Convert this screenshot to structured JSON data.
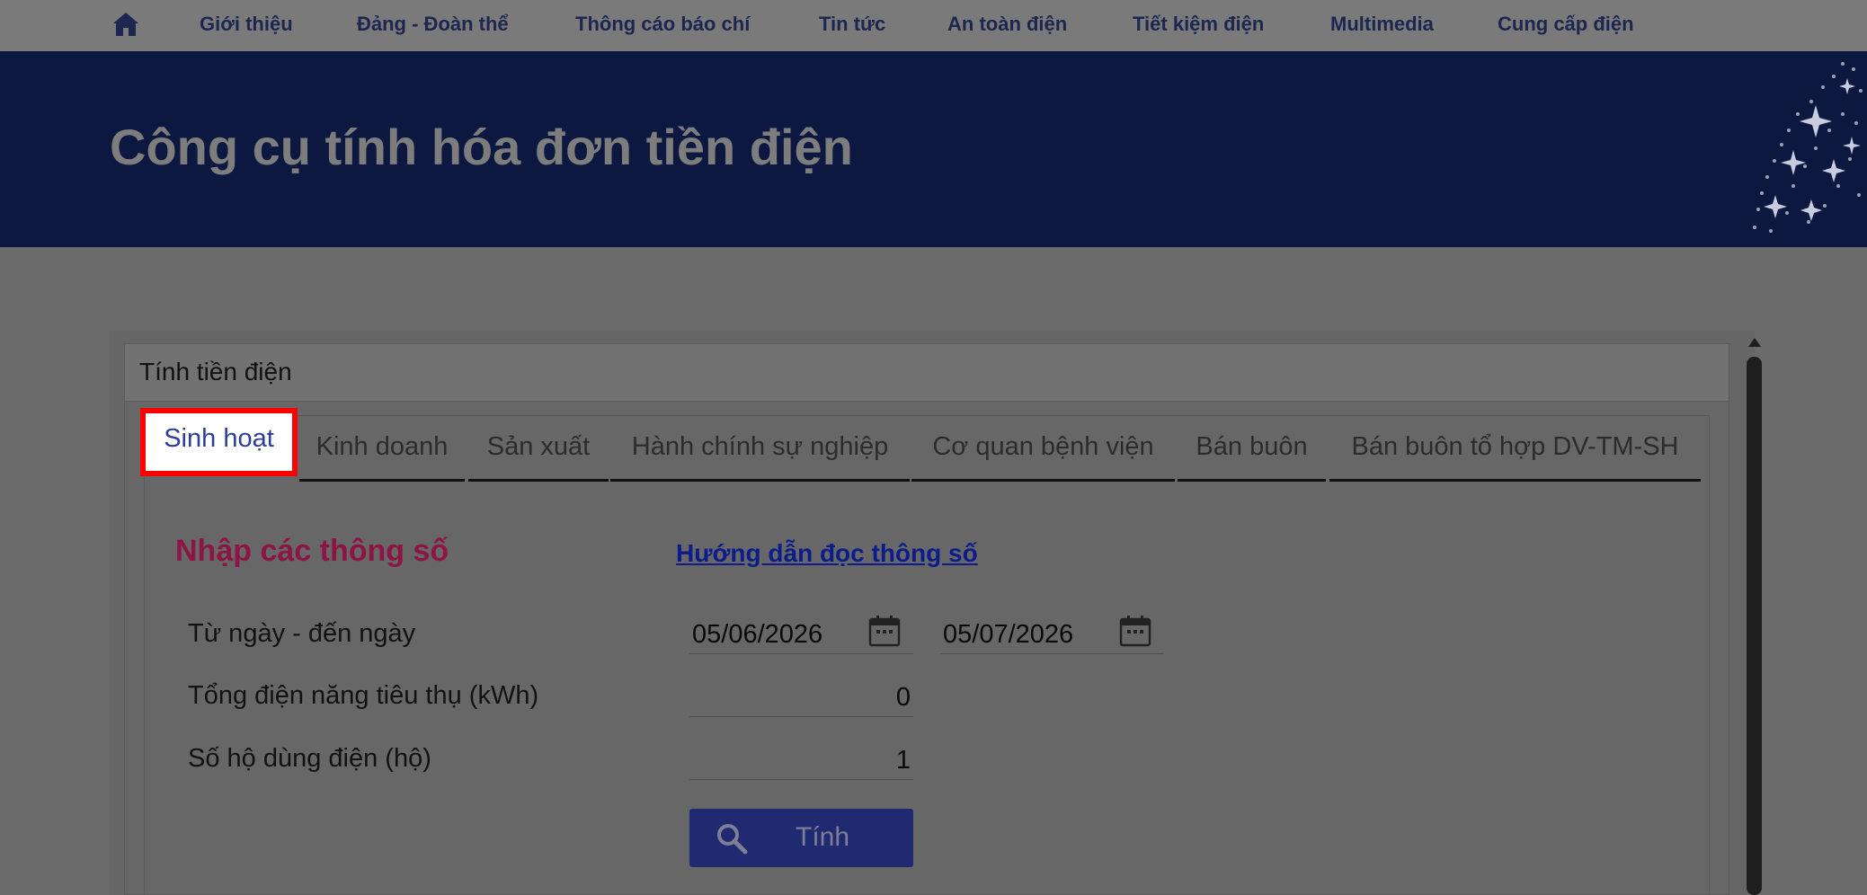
{
  "nav": {
    "home_icon": "home-icon",
    "items": [
      "Giới thiệu",
      "Đảng - Đoàn thể",
      "Thông cáo báo chí",
      "Tin tức",
      "An toàn điện",
      "Tiết kiệm điện",
      "Multimedia",
      "Cung cấp điện"
    ]
  },
  "banner": {
    "title": "Công cụ tính hóa đơn tiền điện"
  },
  "panel": {
    "title": "Tính tiền điện"
  },
  "tabs": [
    {
      "label": "Sinh hoạt",
      "active": true
    },
    {
      "label": "Kinh doanh"
    },
    {
      "label": "Sản xuất"
    },
    {
      "label": "Hành chính sự nghiệp"
    },
    {
      "label": "Cơ quan bệnh viện"
    },
    {
      "label": "Bán buôn"
    },
    {
      "label": "Bán buôn tổ hợp DV-TM-SH"
    }
  ],
  "form": {
    "section_title": "Nhập các thông số",
    "guide_link": "Hướng dẫn đọc thông số",
    "date_range_label": "Từ ngày - đến ngày",
    "from_date": "05/06/2026",
    "to_date": "05/07/2026",
    "energy_label": "Tổng điện năng tiêu thụ (kWh)",
    "energy_value": "0",
    "households_label": "Số hộ dùng điện (hộ)",
    "households_value": "1",
    "calc_button": "Tính"
  },
  "colors": {
    "banner_bg": "#0c1840",
    "active_tab_highlight": "#ff0000",
    "section_title": "#8c1545",
    "button_bg": "#1f2a70"
  }
}
